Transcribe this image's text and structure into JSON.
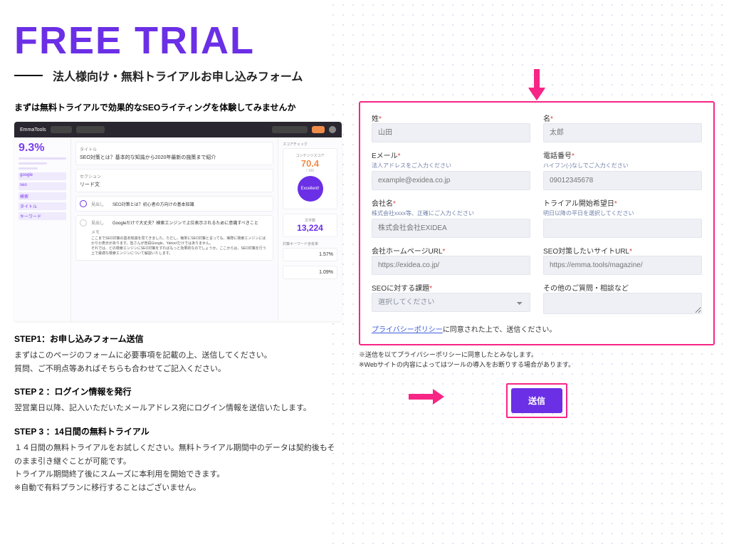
{
  "hero": {
    "title": "FREE TRIAL",
    "subtitle": "法人様向け・無料トライアルお申し込みフォーム"
  },
  "left": {
    "lead": "まずは無料トライアルで効果的なSEOライティングを体験してみませんか",
    "screenshot": {
      "tool_name": "EmmaTools",
      "score_pct": "9.3%",
      "content_score": "70.4",
      "content_score_sub": "/ 100",
      "badge": "Excellent!",
      "char_count": "13,224",
      "kw_side": [
        "google",
        "seo",
        "検索",
        "タイトル",
        "キーワード"
      ],
      "title_label": "タイトル",
      "title_text": "SEO対策とは？基本的な知識から2020年最新の施策まで紹介",
      "section_label": "セクション",
      "section_text": "リード文",
      "row1_label": "見出し",
      "row1_text": "SEO対策とは？初心者の方向けの基本知識",
      "row2_label": "見出し",
      "row2_text": "Googleだけで大丈夫？検索エンジンで上位表示されるために意識すべきこと",
      "memo_label": "メモ",
      "memo_text": "ここまでSEO対策の基本知識を見てきました。ただし、簡単にSEO対策と言っても、実際に検索エンジンにばかりか表示があります。皆さんが普段Google、Yahoo!だけではありません。\nそれでは、どの検索エンジンにSEO対策をすればもっと効果的なのでしょうか。ここからは、SEO対策を行う上で最適な検索エンジンについて解説いたします。",
      "right_rate1": "1.57%",
      "right_rate2": "1.09%",
      "score_label": "スコアチェック",
      "content_score_label": "コンテンツスコア",
      "char_label": "文字数",
      "kw_label": "対策キーワード含有率"
    },
    "steps": [
      {
        "title": "STEP1：お申し込みフォーム送信",
        "body": "まずはこのページのフォームに必要事項を記載の上、送信してください。\n質問、ご不明点等あればそちらも合わせてご記入ください。"
      },
      {
        "title": "STEP 2 ：ログイン情報を発行",
        "body": "翌営業日以降、記入いただいたメールアドレス宛にログイン情報を送信いたします。"
      },
      {
        "title": "STEP 3 ：14日間の無料トライアル",
        "body": "１４日間の無料トライアルをお試しください。無料トライアル期間中のデータは契約後もそのまま引き継ぐことが可能です。\nトライアル期間終了後にスムーズに本利用を開始できます。\n※自動で有料プランに移行することはございません。"
      }
    ]
  },
  "form": {
    "lastname": {
      "label": "姓",
      "placeholder": "山田"
    },
    "firstname": {
      "label": "名",
      "placeholder": "太郎"
    },
    "email": {
      "label": "Eメール",
      "hint": "法人アドレスをご入力ください",
      "placeholder": "example@exidea.co.jp"
    },
    "phone": {
      "label": "電話番号",
      "hint": "ハイフン(-)なしでご入力ください",
      "placeholder": "09012345678"
    },
    "company": {
      "label": "会社名",
      "hint": "株式会社xxxx等、正確にご入力ください",
      "placeholder": "株式会社会社EXIDEA"
    },
    "startdate": {
      "label": "トライアル開始希望日",
      "hint": "明日以降の平日を選択してください",
      "placeholder": ""
    },
    "companyurl": {
      "label": "会社ホームページURL",
      "placeholder": "https://exidea.co.jp/"
    },
    "siteurl": {
      "label": "SEO対策したいサイトURL",
      "placeholder": "https://emma.tools/magazine/"
    },
    "issue": {
      "label": "SEOに対する課題",
      "placeholder": "選択してください"
    },
    "other": {
      "label": "その他のご質問・相談など"
    },
    "privacy_link": "プライバシーポリシー",
    "privacy_suffix": "に同意された上で、送信ください。",
    "note1": "※送信を以てプライバシーポリシーに同意したとみなします。",
    "note2": "※Webサイトの内容によってはツールの導入をお断りする場合があります。",
    "submit": "送信"
  }
}
